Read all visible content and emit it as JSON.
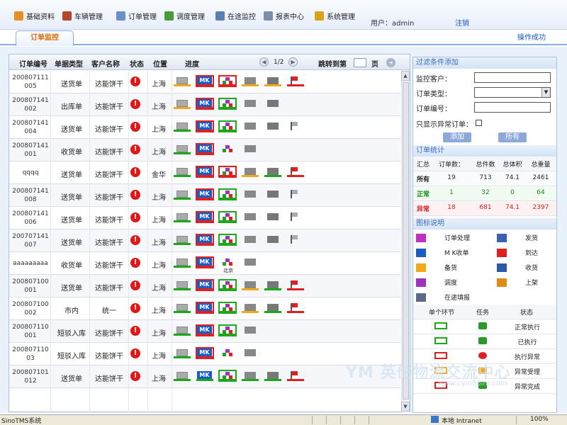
{
  "menu": [
    {
      "label": "基础资料",
      "icon": "document-edit-icon",
      "color": "#e49025"
    },
    {
      "label": "车辆管理",
      "icon": "truck-icon",
      "color": "#b4442a"
    },
    {
      "label": "订单管理",
      "icon": "order-list-icon",
      "color": "#6b8fc7"
    },
    {
      "label": "调度管理",
      "icon": "dispatch-icon",
      "color": "#4a9a3a"
    },
    {
      "label": "在途监控",
      "icon": "magnifier-icon",
      "color": "#5a7fb3"
    },
    {
      "label": "报表中心",
      "icon": "report-icon",
      "color": "#7a8ea8"
    },
    {
      "label": "系统管理",
      "icon": "settings-icon",
      "color": "#d9a21a"
    }
  ],
  "user_label": "用户：admin",
  "logout_label": "注销",
  "tab_label": "订单监控",
  "op_status": "操作成功",
  "columns": [
    "订单编号",
    "单据类型",
    "客户名称",
    "状态",
    "位置",
    "进度"
  ],
  "pager": {
    "page": "1/2",
    "jump_label": "跳转到第",
    "page_suffix": "页"
  },
  "rows": [
    {
      "no": "200807111005",
      "type": "送货单",
      "customer": "达能饼干",
      "status": "!",
      "location": "上海",
      "progress": [
        "orange",
        "red",
        "red",
        "orange",
        "orange",
        "red"
      ]
    },
    {
      "no": "200807141002",
      "type": "出库单",
      "customer": "达能饼干",
      "status": "!",
      "location": "上海",
      "progress": [
        "orange",
        "red",
        "green",
        "none",
        "none"
      ]
    },
    {
      "no": "200807141004",
      "type": "送货单",
      "customer": "达能饼干",
      "status": "!",
      "location": "上海",
      "progress": [
        "green",
        "red",
        "green",
        "none",
        "none",
        "none"
      ]
    },
    {
      "no": "200807141001",
      "type": "收货单",
      "customer": "达能饼干",
      "status": "!",
      "location": "上海",
      "progress": [
        "green",
        "red",
        "none",
        "none"
      ]
    },
    {
      "no": "qqqq",
      "type": "送货单",
      "customer": "达能饼干",
      "status": "!",
      "location": "金华",
      "progress": [
        "green",
        "red",
        "red",
        "orange",
        "green",
        "red"
      ]
    },
    {
      "no": "200807141008",
      "type": "送货单",
      "customer": "达能饼干",
      "status": "!",
      "location": "上海",
      "progress": [
        "green",
        "red",
        "green",
        "none",
        "none",
        "none"
      ]
    },
    {
      "no": "200807141006",
      "type": "送货单",
      "customer": "达能饼干",
      "status": "!",
      "location": "上海",
      "progress": [
        "green",
        "red",
        "green",
        "none",
        "none",
        "none"
      ]
    },
    {
      "no": "200707141007",
      "type": "送货单",
      "customer": "达能饼干",
      "status": "!",
      "location": "上海",
      "progress": [
        "green",
        "red",
        "green",
        "none",
        "none",
        "none"
      ]
    },
    {
      "no": "aaaaaaaaa",
      "type": "收货单",
      "customer": "达能饼干",
      "status": "!",
      "location": "上海",
      "progress": [
        "green",
        "red",
        "none",
        "none"
      ],
      "sublabel": "北京"
    },
    {
      "no": "200807100001",
      "type": "送货单",
      "customer": "达能饼干",
      "status": "!",
      "location": "上海",
      "progress": [
        "green",
        "red",
        "green",
        "orange",
        "green",
        "red"
      ]
    },
    {
      "no": "200807100002",
      "type": "市内",
      "customer": "统一",
      "status": "!",
      "location": "上海",
      "progress": [
        "green",
        "red",
        "green",
        "orange",
        "green",
        "red"
      ]
    },
    {
      "no": "200807110001",
      "type": "短驳入库",
      "customer": "达能饼干",
      "status": "!",
      "location": "上海",
      "progress": [
        "green",
        "red",
        "green",
        "none"
      ]
    },
    {
      "no": "20080711003",
      "type": "短驳入库",
      "customer": "达能饼干",
      "status": "!",
      "location": "上海",
      "progress": [
        "green",
        "red",
        "none",
        "none"
      ]
    },
    {
      "no": "200807101012",
      "type": "送货单",
      "customer": "达能饼干",
      "status": "!",
      "location": "上海",
      "progress": [
        "green",
        "green",
        "green",
        "green",
        "green",
        "red"
      ]
    }
  ],
  "filter": {
    "title": "过滤条件添加",
    "customer_label": "监控客户：",
    "order_type_label": "订单类型：",
    "order_no_label": "订单编号：",
    "exception_only_label": "只显示异常订单：",
    "add_button": "添加",
    "all_button": "所有"
  },
  "stats": {
    "title": "订单统计",
    "headers": [
      "汇总",
      "订单数：",
      "总件数",
      "总体积",
      "总重量"
    ],
    "rows": [
      {
        "label": "所有",
        "count": "19",
        "pieces": "713",
        "volume": "74.1",
        "weight": "2461",
        "color": "#222222"
      },
      {
        "label": "正常",
        "count": "1",
        "pieces": "32",
        "volume": "0",
        "weight": "64",
        "color": "#1a8a1a"
      },
      {
        "label": "异常",
        "count": "18",
        "pieces": "681",
        "volume": "74.1",
        "weight": "2397",
        "color": "#d42020"
      }
    ]
  },
  "legend": {
    "title": "图标说明",
    "items": [
      {
        "label": "订单处理",
        "icon": "order-process-icon"
      },
      {
        "label": "发货",
        "icon": "ship-icon"
      },
      {
        "label": "M K收单",
        "icon": "mk-receive-icon"
      },
      {
        "label": "到达",
        "icon": "arrive-flag-icon"
      },
      {
        "label": "备货",
        "icon": "stock-icon"
      },
      {
        "label": "收货",
        "icon": "receive-icon"
      },
      {
        "label": "调度",
        "icon": "dispatch-icon"
      },
      {
        "label": "上架",
        "icon": "shelve-icon"
      },
      {
        "label": "在途填报",
        "icon": "transit-report-icon"
      }
    ]
  },
  "tasks": {
    "headers": [
      "单个环节",
      "任务",
      "状态"
    ],
    "rows": [
      {
        "status": "正常执行",
        "box_color": "#19a919",
        "task_icon": "arrow-right-icon"
      },
      {
        "status": "已执行",
        "box_color": "#19a919",
        "task_icon": "check-icon"
      },
      {
        "status": "执行异常",
        "box_color": "#e02020",
        "task_icon": "error-icon"
      },
      {
        "status": "异常受理",
        "box_color": "#f1a91a",
        "task_icon": "wrench-icon"
      },
      {
        "status": "异常完成",
        "box_color": "#e02020",
        "task_icon": "done-icon"
      }
    ]
  },
  "statusbar": {
    "left": "SinoTMS系统",
    "zone": "本地 Intranet",
    "zoom": "100%"
  },
  "watermark": {
    "text": "YM 英伦物流交流中心",
    "url": "www.cym56lm.com"
  }
}
